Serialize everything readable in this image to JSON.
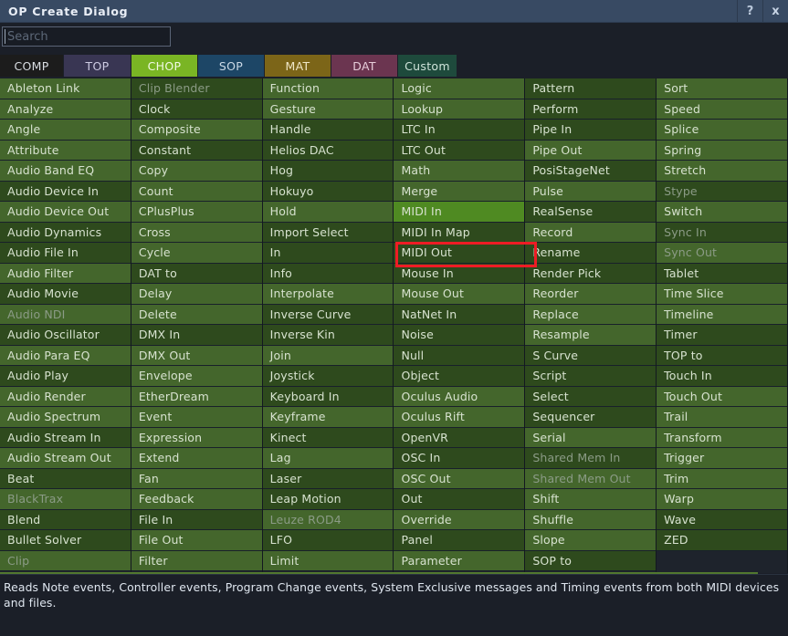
{
  "window": {
    "title": "OP Create Dialog",
    "help_button": "?",
    "close_button": "x"
  },
  "search": {
    "value": "",
    "placeholder": "Search"
  },
  "tabs": [
    {
      "label": "COMP",
      "bg": "#1c1c1c",
      "fg": "#d9dde2",
      "width": 70,
      "active": false
    },
    {
      "label": "TOP",
      "bg": "#393653",
      "fg": "#cdcbe2",
      "width": 74,
      "active": false
    },
    {
      "label": "CHOP",
      "bg": "#7ab524",
      "fg": "#f2fae6",
      "width": 73,
      "active": true
    },
    {
      "label": "SOP",
      "bg": "#1d4666",
      "fg": "#cbd9e6",
      "width": 73,
      "active": false
    },
    {
      "label": "MAT",
      "bg": "#7c6518",
      "fg": "#efe6c6",
      "width": 73,
      "active": false
    },
    {
      "label": "DAT",
      "bg": "#6b3550",
      "fg": "#e7cdda",
      "width": 73,
      "active": false
    },
    {
      "label": "Custom",
      "bg": "#1e4a3c",
      "fg": "#cfe3da",
      "width": 65,
      "active": false
    }
  ],
  "colors": {
    "accent_chop": "#7ab524",
    "row_light": "#44662c",
    "row_dark": "#2e4a1d",
    "row_highlight": "#4f8a22",
    "annotation": "#ee1c25",
    "titlebar": "#384a63"
  },
  "selection": {
    "hovered_item": "MIDI In",
    "annotated_item": "MIDI Out"
  },
  "columns": [
    {
      "items": [
        {
          "label": "Ableton Link",
          "shade": "a",
          "state": "normal"
        },
        {
          "label": "Analyze",
          "shade": "a",
          "state": "normal"
        },
        {
          "label": "Angle",
          "shade": "a",
          "state": "normal"
        },
        {
          "label": "Attribute",
          "shade": "a",
          "state": "normal"
        },
        {
          "label": "Audio Band EQ",
          "shade": "a",
          "state": "normal"
        },
        {
          "label": "Audio Device In",
          "shade": "b",
          "state": "normal"
        },
        {
          "label": "Audio Device Out",
          "shade": "a",
          "state": "normal"
        },
        {
          "label": "Audio Dynamics",
          "shade": "b",
          "state": "normal"
        },
        {
          "label": "Audio File In",
          "shade": "b",
          "state": "normal"
        },
        {
          "label": "Audio Filter",
          "shade": "a",
          "state": "normal"
        },
        {
          "label": "Audio Movie",
          "shade": "b",
          "state": "normal"
        },
        {
          "label": "Audio NDI",
          "shade": "a",
          "state": "disabled"
        },
        {
          "label": "Audio Oscillator",
          "shade": "b",
          "state": "normal"
        },
        {
          "label": "Audio Para EQ",
          "shade": "a",
          "state": "normal"
        },
        {
          "label": "Audio Play",
          "shade": "b",
          "state": "normal"
        },
        {
          "label": "Audio Render",
          "shade": "a",
          "state": "normal"
        },
        {
          "label": "Audio Spectrum",
          "shade": "a",
          "state": "normal"
        },
        {
          "label": "Audio Stream In",
          "shade": "b",
          "state": "normal"
        },
        {
          "label": "Audio Stream Out",
          "shade": "a",
          "state": "normal"
        },
        {
          "label": "Beat",
          "shade": "b",
          "state": "normal"
        },
        {
          "label": "BlackTrax",
          "shade": "a",
          "state": "disabled"
        },
        {
          "label": "Blend",
          "shade": "b",
          "state": "normal"
        },
        {
          "label": "Bullet Solver",
          "shade": "b",
          "state": "normal"
        },
        {
          "label": "Clip",
          "shade": "a",
          "state": "disabled"
        }
      ]
    },
    {
      "items": [
        {
          "label": "Clip Blender",
          "shade": "b",
          "state": "disabled"
        },
        {
          "label": "Clock",
          "shade": "b",
          "state": "normal"
        },
        {
          "label": "Composite",
          "shade": "a",
          "state": "normal"
        },
        {
          "label": "Constant",
          "shade": "b",
          "state": "normal"
        },
        {
          "label": "Copy",
          "shade": "a",
          "state": "normal"
        },
        {
          "label": "Count",
          "shade": "a",
          "state": "normal"
        },
        {
          "label": "CPlusPlus",
          "shade": "a",
          "state": "normal"
        },
        {
          "label": "Cross",
          "shade": "a",
          "state": "normal"
        },
        {
          "label": "Cycle",
          "shade": "a",
          "state": "normal"
        },
        {
          "label": "DAT to",
          "shade": "b",
          "state": "normal"
        },
        {
          "label": "Delay",
          "shade": "a",
          "state": "normal"
        },
        {
          "label": "Delete",
          "shade": "a",
          "state": "normal"
        },
        {
          "label": "DMX In",
          "shade": "b",
          "state": "normal"
        },
        {
          "label": "DMX Out",
          "shade": "a",
          "state": "normal"
        },
        {
          "label": "Envelope",
          "shade": "a",
          "state": "normal"
        },
        {
          "label": "EtherDream",
          "shade": "a",
          "state": "normal"
        },
        {
          "label": "Event",
          "shade": "a",
          "state": "normal"
        },
        {
          "label": "Expression",
          "shade": "a",
          "state": "normal"
        },
        {
          "label": "Extend",
          "shade": "a",
          "state": "normal"
        },
        {
          "label": "Fan",
          "shade": "a",
          "state": "normal"
        },
        {
          "label": "Feedback",
          "shade": "a",
          "state": "normal"
        },
        {
          "label": "File In",
          "shade": "b",
          "state": "normal"
        },
        {
          "label": "File Out",
          "shade": "a",
          "state": "normal"
        },
        {
          "label": "Filter",
          "shade": "a",
          "state": "normal"
        }
      ]
    },
    {
      "items": [
        {
          "label": "Function",
          "shade": "a",
          "state": "normal"
        },
        {
          "label": "Gesture",
          "shade": "a",
          "state": "normal"
        },
        {
          "label": "Handle",
          "shade": "b",
          "state": "normal"
        },
        {
          "label": "Helios DAC",
          "shade": "b",
          "state": "normal"
        },
        {
          "label": "Hog",
          "shade": "b",
          "state": "normal"
        },
        {
          "label": "Hokuyo",
          "shade": "b",
          "state": "normal"
        },
        {
          "label": "Hold",
          "shade": "a",
          "state": "normal"
        },
        {
          "label": "Import Select",
          "shade": "b",
          "state": "normal"
        },
        {
          "label": "In",
          "shade": "b",
          "state": "normal"
        },
        {
          "label": "Info",
          "shade": "b",
          "state": "normal"
        },
        {
          "label": "Interpolate",
          "shade": "a",
          "state": "normal"
        },
        {
          "label": "Inverse Curve",
          "shade": "b",
          "state": "normal"
        },
        {
          "label": "Inverse Kin",
          "shade": "b",
          "state": "normal"
        },
        {
          "label": "Join",
          "shade": "a",
          "state": "normal"
        },
        {
          "label": "Joystick",
          "shade": "b",
          "state": "normal"
        },
        {
          "label": "Keyboard In",
          "shade": "b",
          "state": "normal"
        },
        {
          "label": "Keyframe",
          "shade": "a",
          "state": "normal"
        },
        {
          "label": "Kinect",
          "shade": "b",
          "state": "normal"
        },
        {
          "label": "Lag",
          "shade": "a",
          "state": "normal"
        },
        {
          "label": "Laser",
          "shade": "b",
          "state": "normal"
        },
        {
          "label": "Leap Motion",
          "shade": "b",
          "state": "normal"
        },
        {
          "label": "Leuze ROD4",
          "shade": "a",
          "state": "disabled"
        },
        {
          "label": "LFO",
          "shade": "b",
          "state": "normal"
        },
        {
          "label": "Limit",
          "shade": "a",
          "state": "normal"
        }
      ]
    },
    {
      "items": [
        {
          "label": "Logic",
          "shade": "a",
          "state": "normal"
        },
        {
          "label": "Lookup",
          "shade": "a",
          "state": "normal"
        },
        {
          "label": "LTC In",
          "shade": "b",
          "state": "normal"
        },
        {
          "label": "LTC Out",
          "shade": "b",
          "state": "normal"
        },
        {
          "label": "Math",
          "shade": "a",
          "state": "normal"
        },
        {
          "label": "Merge",
          "shade": "a",
          "state": "normal"
        },
        {
          "label": "MIDI In",
          "shade": "a",
          "state": "hovered"
        },
        {
          "label": "MIDI In Map",
          "shade": "b",
          "state": "normal"
        },
        {
          "label": "MIDI Out",
          "shade": "b",
          "state": "annotated"
        },
        {
          "label": "Mouse In",
          "shade": "b",
          "state": "normal"
        },
        {
          "label": "Mouse Out",
          "shade": "a",
          "state": "normal"
        },
        {
          "label": "NatNet In",
          "shade": "b",
          "state": "normal"
        },
        {
          "label": "Noise",
          "shade": "b",
          "state": "normal"
        },
        {
          "label": "Null",
          "shade": "b",
          "state": "normal"
        },
        {
          "label": "Object",
          "shade": "b",
          "state": "normal"
        },
        {
          "label": "Oculus Audio",
          "shade": "a",
          "state": "normal"
        },
        {
          "label": "Oculus Rift",
          "shade": "a",
          "state": "normal"
        },
        {
          "label": "OpenVR",
          "shade": "b",
          "state": "normal"
        },
        {
          "label": "OSC In",
          "shade": "b",
          "state": "normal"
        },
        {
          "label": "OSC Out",
          "shade": "a",
          "state": "normal"
        },
        {
          "label": "Out",
          "shade": "b",
          "state": "normal"
        },
        {
          "label": "Override",
          "shade": "a",
          "state": "normal"
        },
        {
          "label": "Panel",
          "shade": "b",
          "state": "normal"
        },
        {
          "label": "Parameter",
          "shade": "a",
          "state": "normal"
        }
      ]
    },
    {
      "items": [
        {
          "label": "Pattern",
          "shade": "b",
          "state": "normal"
        },
        {
          "label": "Perform",
          "shade": "b",
          "state": "normal"
        },
        {
          "label": "Pipe In",
          "shade": "b",
          "state": "normal"
        },
        {
          "label": "Pipe Out",
          "shade": "a",
          "state": "normal"
        },
        {
          "label": "PosiStageNet",
          "shade": "b",
          "state": "normal"
        },
        {
          "label": "Pulse",
          "shade": "a",
          "state": "normal"
        },
        {
          "label": "RealSense",
          "shade": "b",
          "state": "normal"
        },
        {
          "label": "Record",
          "shade": "a",
          "state": "normal"
        },
        {
          "label": "Rename",
          "shade": "b",
          "state": "normal"
        },
        {
          "label": "Render Pick",
          "shade": "b",
          "state": "normal"
        },
        {
          "label": "Reorder",
          "shade": "a",
          "state": "normal"
        },
        {
          "label": "Replace",
          "shade": "a",
          "state": "normal"
        },
        {
          "label": "Resample",
          "shade": "a",
          "state": "normal"
        },
        {
          "label": "S Curve",
          "shade": "b",
          "state": "normal"
        },
        {
          "label": "Script",
          "shade": "b",
          "state": "normal"
        },
        {
          "label": "Select",
          "shade": "b",
          "state": "normal"
        },
        {
          "label": "Sequencer",
          "shade": "b",
          "state": "normal"
        },
        {
          "label": "Serial",
          "shade": "a",
          "state": "normal"
        },
        {
          "label": "Shared Mem In",
          "shade": "b",
          "state": "disabled"
        },
        {
          "label": "Shared Mem Out",
          "shade": "a",
          "state": "disabled"
        },
        {
          "label": "Shift",
          "shade": "a",
          "state": "normal"
        },
        {
          "label": "Shuffle",
          "shade": "a",
          "state": "normal"
        },
        {
          "label": "Slope",
          "shade": "a",
          "state": "normal"
        },
        {
          "label": "SOP to",
          "shade": "b",
          "state": "normal"
        }
      ]
    },
    {
      "items": [
        {
          "label": "Sort",
          "shade": "a",
          "state": "normal"
        },
        {
          "label": "Speed",
          "shade": "a",
          "state": "normal"
        },
        {
          "label": "Splice",
          "shade": "a",
          "state": "normal"
        },
        {
          "label": "Spring",
          "shade": "a",
          "state": "normal"
        },
        {
          "label": "Stretch",
          "shade": "a",
          "state": "normal"
        },
        {
          "label": "Stype",
          "shade": "b",
          "state": "disabled"
        },
        {
          "label": "Switch",
          "shade": "a",
          "state": "normal"
        },
        {
          "label": "Sync In",
          "shade": "b",
          "state": "disabled"
        },
        {
          "label": "Sync Out",
          "shade": "a",
          "state": "disabled"
        },
        {
          "label": "Tablet",
          "shade": "b",
          "state": "normal"
        },
        {
          "label": "Time Slice",
          "shade": "a",
          "state": "normal"
        },
        {
          "label": "Timeline",
          "shade": "a",
          "state": "normal"
        },
        {
          "label": "Timer",
          "shade": "b",
          "state": "normal"
        },
        {
          "label": "TOP to",
          "shade": "b",
          "state": "normal"
        },
        {
          "label": "Touch In",
          "shade": "b",
          "state": "normal"
        },
        {
          "label": "Touch Out",
          "shade": "a",
          "state": "normal"
        },
        {
          "label": "Trail",
          "shade": "a",
          "state": "normal"
        },
        {
          "label": "Transform",
          "shade": "a",
          "state": "normal"
        },
        {
          "label": "Trigger",
          "shade": "a",
          "state": "normal"
        },
        {
          "label": "Trim",
          "shade": "a",
          "state": "normal"
        },
        {
          "label": "Warp",
          "shade": "a",
          "state": "normal"
        },
        {
          "label": "Wave",
          "shade": "b",
          "state": "normal"
        },
        {
          "label": "ZED",
          "shade": "b",
          "state": "normal"
        },
        {
          "label": "",
          "shade": "empty",
          "state": "empty"
        }
      ]
    }
  ],
  "footer": {
    "description": "Reads Note events, Controller events, Program Change events, System Exclusive messages and Timing events from both MIDI devices and files."
  }
}
